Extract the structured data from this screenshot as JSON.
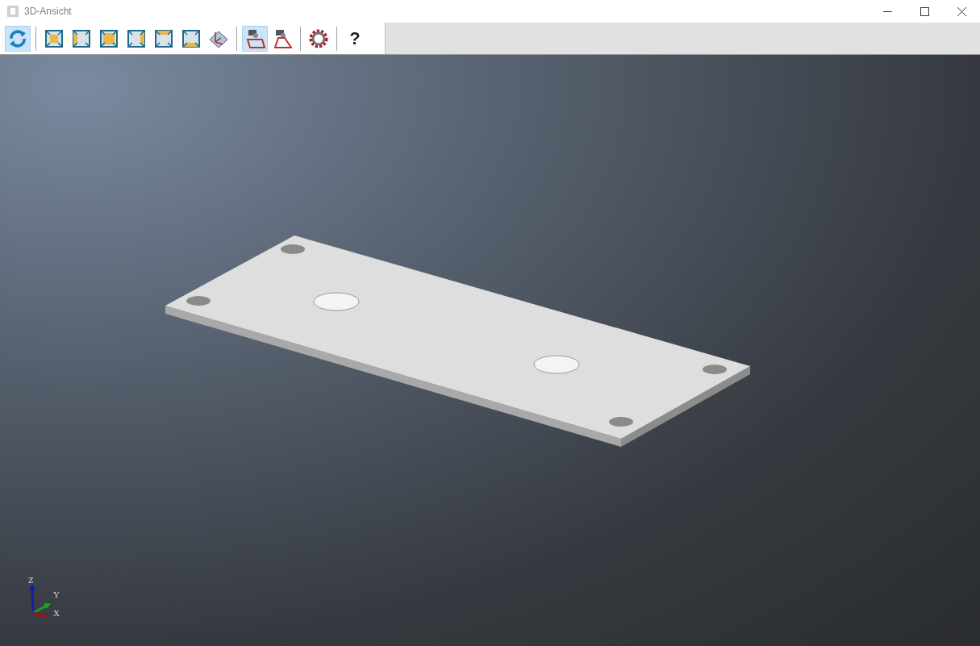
{
  "window": {
    "title": "3D-Ansicht"
  },
  "toolbar": [
    {
      "kind": "refresh",
      "selected": true
    },
    {
      "kind": "separator"
    },
    {
      "kind": "front",
      "selected": false
    },
    {
      "kind": "left",
      "selected": false
    },
    {
      "kind": "back",
      "selected": false
    },
    {
      "kind": "right",
      "selected": false
    },
    {
      "kind": "top",
      "selected": false
    },
    {
      "kind": "bottom",
      "selected": false
    },
    {
      "kind": "axes",
      "selected": false
    },
    {
      "kind": "separator"
    },
    {
      "kind": "camera",
      "selected": true
    },
    {
      "kind": "camera2",
      "selected": false
    },
    {
      "kind": "separator"
    },
    {
      "kind": "gear",
      "selected": false
    },
    {
      "kind": "separator"
    },
    {
      "kind": "text",
      "label": "?",
      "selected": false
    }
  ],
  "viewport": {
    "axis_labels": {
      "z": "Z",
      "y": "Y",
      "x": "X"
    }
  }
}
